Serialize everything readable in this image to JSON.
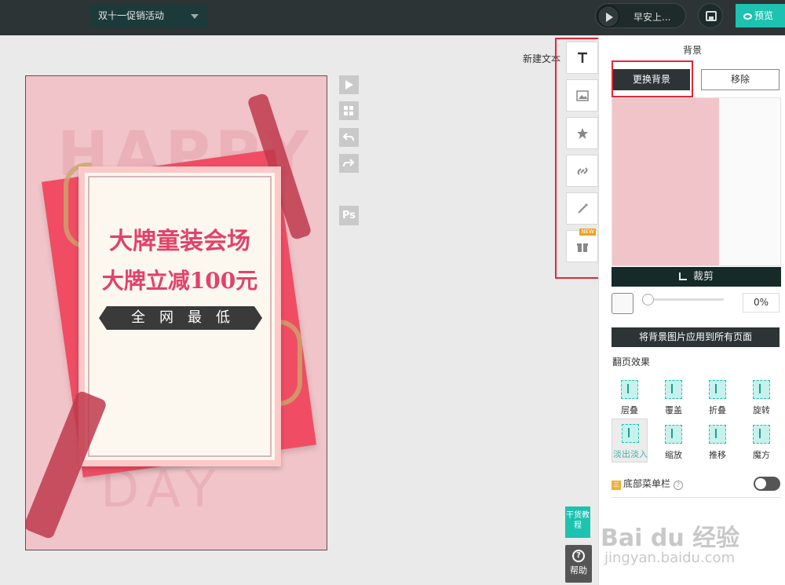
{
  "topbar": {
    "doc_title": "双十一促销活动",
    "music_label": "早安上...",
    "preview_label": "预览"
  },
  "poster": {
    "ghost_top": "HAPPY",
    "ghost_bottom": "DAY",
    "line1": "大牌童装会场",
    "line2": "大牌立减100元",
    "banner": "全网最低"
  },
  "insert": {
    "new_text_label": "新建文本",
    "new_badge": "NEW"
  },
  "panel": {
    "title": "背景",
    "swap_bg": "更换背景",
    "remove": "移除",
    "crop": "裁剪",
    "opacity_value": "0%",
    "apply_all": "将背景图片应用到所有页面",
    "flip_title": "翻页效果",
    "effects": [
      "层叠",
      "覆盖",
      "折叠",
      "旋转",
      "淡出淡入",
      "缩放",
      "推移",
      "魔方"
    ],
    "bottom_menu_label": "底部菜单栏",
    "bottom_menu_icon": "三",
    "help_mark": "?"
  },
  "floating": {
    "tutorial": "干货教程",
    "help": "帮助"
  },
  "watermark": {
    "main": "Bai du 经验",
    "sub": "jingyan.baidu.com"
  },
  "colors": {
    "accent": "#1ec2b0",
    "topbar": "#2d3436",
    "highlight_box": "#e0283a",
    "poster_bg": "#f0c4c8",
    "poster_text": "#e2426a"
  }
}
